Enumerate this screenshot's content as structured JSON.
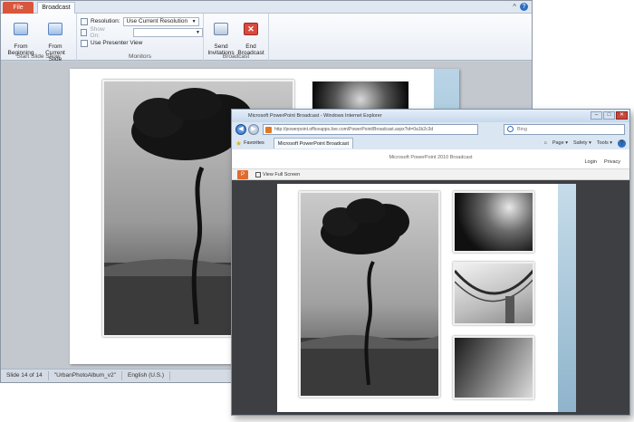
{
  "ppt": {
    "tabs": {
      "file": "File",
      "broadcast": "Broadcast"
    },
    "ribbon": {
      "start_slide_show": {
        "from_beginning": "From\nBeginning",
        "from_current": "From\nCurrent Slide",
        "label": "Start Slide Show"
      },
      "monitors": {
        "resolution_label": "Resolution:",
        "resolution_value": "Use Current Resolution",
        "show_on_label": "Show On:",
        "presenter_view": "Use Presenter View",
        "label": "Monitors"
      },
      "broadcast": {
        "send_invitations": "Send\nInvitations",
        "end_broadcast": "End\nBroadcast",
        "label": "Broadcast"
      }
    },
    "status": {
      "slide": "Slide 14 of 14",
      "theme": "\"UrbanPhotoAlbum_v2\"",
      "language": "English (U.S.)"
    }
  },
  "ie": {
    "title": "Microsoft PowerPoint Broadcast - Windows Internet Explorer",
    "address": "http://powerpoint.officeapps.live.com/PowerPoint/Broadcast.aspx?id=0a1b2c3d",
    "search_placeholder": "Bing",
    "favorites": "Favorites",
    "fav_tab": "Microsoft PowerPoint Broadcast",
    "cmd": {
      "page": "Page ▾",
      "safety": "Safety ▾",
      "tools": "Tools ▾"
    },
    "page_title": "Microsoft PowerPoint 2010 Broadcast",
    "links": {
      "login": "Login",
      "privacy": "Privacy"
    },
    "viewer": {
      "full_screen": "View Full Screen"
    }
  },
  "colors": {
    "file_tab": "#d8563b",
    "slide_accent": "#7fa9c4",
    "viewer_bg": "#3d3f42"
  }
}
